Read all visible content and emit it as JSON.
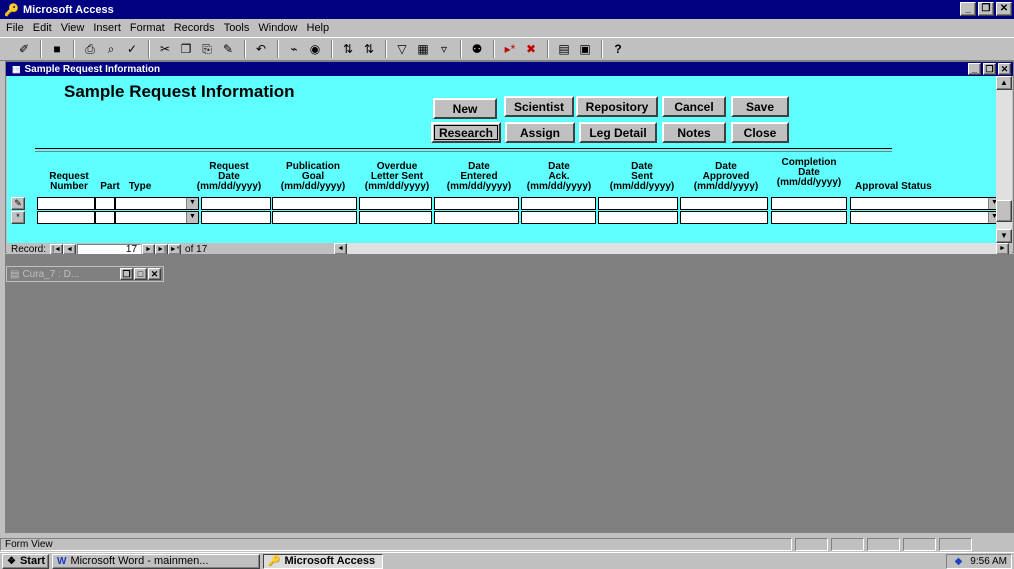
{
  "app": {
    "title": "Microsoft Access",
    "title_icon": "access-key-icon",
    "controls": {
      "minimize": "_",
      "restore": "❒",
      "close": "✕"
    }
  },
  "menu": {
    "items": [
      {
        "label": "File"
      },
      {
        "label": "Edit"
      },
      {
        "label": "View"
      },
      {
        "label": "Insert"
      },
      {
        "label": "Format"
      },
      {
        "label": "Records"
      },
      {
        "label": "Tools"
      },
      {
        "label": "Window"
      },
      {
        "label": "Help"
      }
    ]
  },
  "toolbar": {
    "icons": [
      "view-icon",
      "save-icon",
      "print-icon",
      "print-preview-icon",
      "spelling-icon",
      "cut-icon",
      "copy-icon",
      "paste-icon",
      "format-painter-icon",
      "undo-icon",
      "insert-hyperlink-icon",
      "web-toolbar-icon",
      "sort-ascending-icon",
      "sort-descending-icon",
      "filter-by-selection-icon",
      "filter-by-form-icon",
      "apply-filter-icon",
      "find-icon",
      "new-record-icon",
      "delete-record-icon",
      "database-window-icon",
      "new-object-icon",
      "help-icon"
    ],
    "glyphs": {
      "view": "✐",
      "save": "■",
      "print": "⎙",
      "preview": "⌕",
      "spelling": "✓",
      "cut": "✂",
      "copy": "❐",
      "paste": "⎘",
      "painter": "✎",
      "undo": "↶",
      "hyperlink": "⌁",
      "web": "◉",
      "sort_asc": "⇅",
      "sort_desc": "⇅",
      "filter_sel": "▽",
      "filter_form": "▦",
      "filter_apply": "▿",
      "find": "⚉",
      "new_record": "▸*",
      "delete_record": "✖",
      "db_window": "▤",
      "new_object": "▣",
      "help": "?"
    }
  },
  "form": {
    "window_title": "Sample Request Information",
    "header_title": "Sample Request Information",
    "buttons": {
      "new": "New",
      "scientist": "Scientist",
      "repository": "Repository",
      "cancel": "Cancel",
      "save": "Save",
      "research": "Research",
      "assign": "Assign",
      "leg_detail": "Leg Detail",
      "notes": "Notes",
      "close": "Close"
    },
    "columns": [
      {
        "key": "request_number",
        "l1": "Request",
        "l2": "Number",
        "l3": ""
      },
      {
        "key": "part",
        "l1": "",
        "l2": "Part",
        "l3": ""
      },
      {
        "key": "type",
        "l1": "",
        "l2": "Type",
        "l3": ""
      },
      {
        "key": "request_date",
        "l1": "Request",
        "l2": "Date",
        "l3": "(mm/dd/yyyy)"
      },
      {
        "key": "publication_goal",
        "l1": "Publication",
        "l2": "Goal",
        "l3": "(mm/dd/yyyy)"
      },
      {
        "key": "overdue_letter_sent",
        "l1": "Overdue",
        "l2": "Letter Sent",
        "l3": "(mm/dd/yyyy)"
      },
      {
        "key": "date_entered",
        "l1": "Date",
        "l2": "Entered",
        "l3": "(mm/dd/yyyy)"
      },
      {
        "key": "date_ack",
        "l1": "Date",
        "l2": "Ack.",
        "l3": "(mm/dd/yyyy)"
      },
      {
        "key": "date_sent",
        "l1": "Date",
        "l2": "Sent",
        "l3": "(mm/dd/yyyy)"
      },
      {
        "key": "date_approved",
        "l1": "Date",
        "l2": "Approved",
        "l3": "(mm/dd/yyyy)"
      },
      {
        "key": "completion_date",
        "l1": "Completion",
        "l2": "Date",
        "l3": "(mm/dd/yyyy)"
      },
      {
        "key": "approval_status",
        "l1": "",
        "l2": "Approval Status",
        "l3": ""
      }
    ],
    "row_selectors": {
      "current": "✎",
      "new": "*"
    }
  },
  "navigation": {
    "record_label": "Record:",
    "current_record": "17",
    "total_label": "of 17",
    "first": "|◄",
    "prev": "◄",
    "next": "►",
    "last": "►|",
    "new": "►*"
  },
  "minimized_window": {
    "title": "Cura_7 : D...",
    "icon": "database-icon"
  },
  "status": {
    "text": "Form View"
  },
  "taskbar": {
    "start_label": "Start",
    "tasks": [
      {
        "label": "Microsoft Word - mainmen...",
        "icon": "word-icon"
      },
      {
        "label": "Microsoft Access",
        "icon": "access-key-icon",
        "active": true
      }
    ],
    "clock": "9:56 AM",
    "tray_icon": "shield-icon"
  }
}
